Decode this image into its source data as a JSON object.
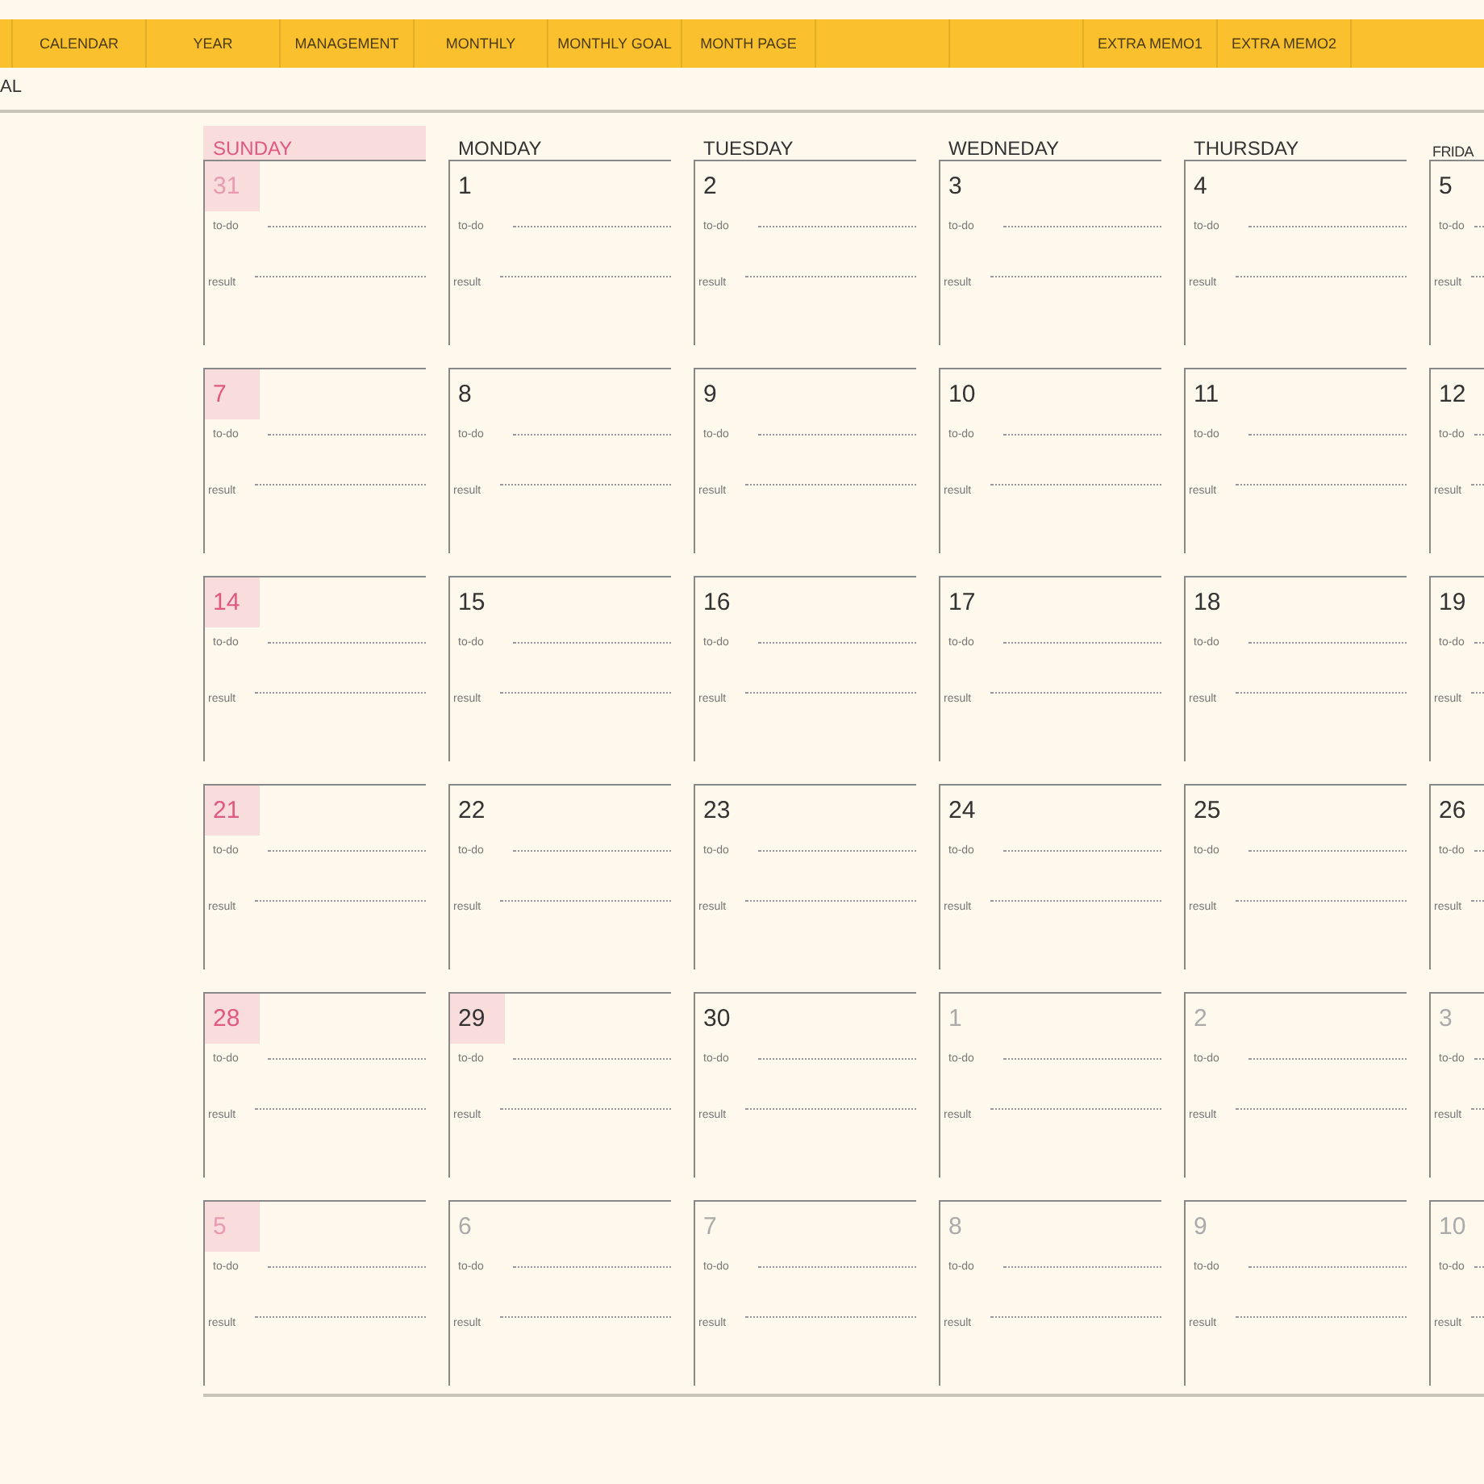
{
  "nav": {
    "tabs": [
      {
        "kind": "blank"
      },
      {
        "kind": "link",
        "label": "CALENDAR"
      },
      {
        "kind": "link",
        "label": "YEAR"
      },
      {
        "kind": "link",
        "label": "MANAGEMENT"
      },
      {
        "kind": "link",
        "label": "MONTHLY"
      },
      {
        "kind": "link",
        "label": "MONTHLY GOAL"
      },
      {
        "kind": "link",
        "label": "MONTH PAGE"
      },
      {
        "kind": "blank"
      },
      {
        "kind": "blank"
      },
      {
        "kind": "link",
        "label": "EXTRA MEMO1"
      },
      {
        "kind": "link",
        "label": "EXTRA MEMO2"
      }
    ]
  },
  "subtitle": "AL",
  "calendar": {
    "columns": [
      {
        "label": "SUNDAY",
        "holiday": true
      },
      {
        "label": "MONDAY",
        "holiday": false
      },
      {
        "label": "TUESDAY",
        "holiday": false
      },
      {
        "label": "WEDNEDAY",
        "holiday": false
      },
      {
        "label": "THURSDAY",
        "holiday": false
      },
      {
        "label": "FRIDA",
        "holiday": false
      }
    ],
    "weeks": [
      [
        {
          "day": "31",
          "other_month": true,
          "highlighted": true,
          "todo": "to-do",
          "result": "result"
        },
        {
          "day": "1",
          "other_month": false,
          "highlighted": false,
          "todo": "to-do",
          "result": "result"
        },
        {
          "day": "2",
          "other_month": false,
          "highlighted": false,
          "todo": "to-do",
          "result": "result"
        },
        {
          "day": "3",
          "other_month": false,
          "highlighted": false,
          "todo": "to-do",
          "result": "result"
        },
        {
          "day": "4",
          "other_month": false,
          "highlighted": false,
          "todo": "to-do",
          "result": "result"
        },
        {
          "day": "5",
          "other_month": false,
          "highlighted": false,
          "todo": "to-do",
          "result": "result"
        }
      ],
      [
        {
          "day": "7",
          "other_month": false,
          "highlighted": true,
          "todo": "to-do",
          "result": "result"
        },
        {
          "day": "8",
          "other_month": false,
          "highlighted": false,
          "todo": "to-do",
          "result": "result"
        },
        {
          "day": "9",
          "other_month": false,
          "highlighted": false,
          "todo": "to-do",
          "result": "result"
        },
        {
          "day": "10",
          "other_month": false,
          "highlighted": false,
          "todo": "to-do",
          "result": "result"
        },
        {
          "day": "11",
          "other_month": false,
          "highlighted": false,
          "todo": "to-do",
          "result": "result"
        },
        {
          "day": "12",
          "other_month": false,
          "highlighted": false,
          "todo": "to-do",
          "result": "result"
        }
      ],
      [
        {
          "day": "14",
          "other_month": false,
          "highlighted": true,
          "todo": "to-do",
          "result": "result"
        },
        {
          "day": "15",
          "other_month": false,
          "highlighted": false,
          "todo": "to-do",
          "result": "result"
        },
        {
          "day": "16",
          "other_month": false,
          "highlighted": false,
          "todo": "to-do",
          "result": "result"
        },
        {
          "day": "17",
          "other_month": false,
          "highlighted": false,
          "todo": "to-do",
          "result": "result"
        },
        {
          "day": "18",
          "other_month": false,
          "highlighted": false,
          "todo": "to-do",
          "result": "result"
        },
        {
          "day": "19",
          "other_month": false,
          "highlighted": false,
          "todo": "to-do",
          "result": "result"
        }
      ],
      [
        {
          "day": "21",
          "other_month": false,
          "highlighted": true,
          "todo": "to-do",
          "result": "result"
        },
        {
          "day": "22",
          "other_month": false,
          "highlighted": false,
          "todo": "to-do",
          "result": "result"
        },
        {
          "day": "23",
          "other_month": false,
          "highlighted": false,
          "todo": "to-do",
          "result": "result"
        },
        {
          "day": "24",
          "other_month": false,
          "highlighted": false,
          "todo": "to-do",
          "result": "result"
        },
        {
          "day": "25",
          "other_month": false,
          "highlighted": false,
          "todo": "to-do",
          "result": "result"
        },
        {
          "day": "26",
          "other_month": false,
          "highlighted": false,
          "todo": "to-do",
          "result": "result"
        }
      ],
      [
        {
          "day": "28",
          "other_month": false,
          "highlighted": true,
          "todo": "to-do",
          "result": "result"
        },
        {
          "day": "29",
          "other_month": false,
          "highlighted": true,
          "todo": "to-do",
          "result": "result"
        },
        {
          "day": "30",
          "other_month": false,
          "highlighted": false,
          "todo": "to-do",
          "result": "result"
        },
        {
          "day": "1",
          "other_month": true,
          "highlighted": false,
          "todo": "to-do",
          "result": "result"
        },
        {
          "day": "2",
          "other_month": true,
          "highlighted": false,
          "todo": "to-do",
          "result": "result"
        },
        {
          "day": "3",
          "other_month": true,
          "highlighted": false,
          "todo": "to-do",
          "result": "result"
        }
      ],
      [
        {
          "day": "5",
          "other_month": true,
          "highlighted": true,
          "todo": "to-do",
          "result": "result"
        },
        {
          "day": "6",
          "other_month": true,
          "highlighted": false,
          "todo": "to-do",
          "result": "result"
        },
        {
          "day": "7",
          "other_month": true,
          "highlighted": false,
          "todo": "to-do",
          "result": "result"
        },
        {
          "day": "8",
          "other_month": true,
          "highlighted": false,
          "todo": "to-do",
          "result": "result"
        },
        {
          "day": "9",
          "other_month": true,
          "highlighted": false,
          "todo": "to-do",
          "result": "result"
        },
        {
          "day": "10",
          "other_month": true,
          "highlighted": false,
          "todo": "to-do",
          "result": "result"
        }
      ]
    ]
  }
}
